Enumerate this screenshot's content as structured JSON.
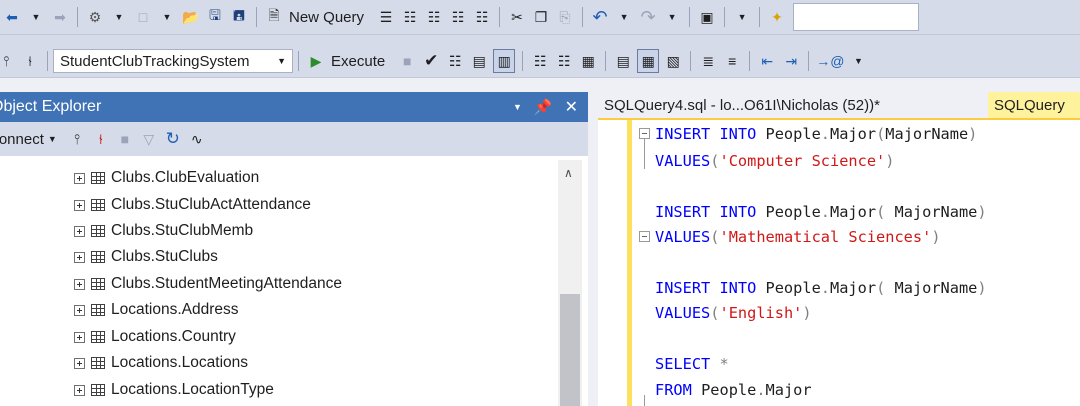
{
  "toolbar": {
    "new_query_label": "New Query",
    "database": "StudentClubTrackingSystem",
    "execute_label": "Execute"
  },
  "object_explorer": {
    "title": "Object Explorer",
    "connect_label": "Connect",
    "items": [
      "Clubs.ClubEvaluation",
      "Clubs.StuClubActAttendance",
      "Clubs.StuClubMemb",
      "Clubs.StuClubs",
      "Clubs.StudentMeetingAttendance",
      "Locations.Address",
      "Locations.Country",
      "Locations.Locations",
      "Locations.LocationType"
    ]
  },
  "editor": {
    "active_tab": "SQLQuery4.sql - lo...O61I\\Nicholas (52))*",
    "second_tab": "SQLQuery"
  }
}
